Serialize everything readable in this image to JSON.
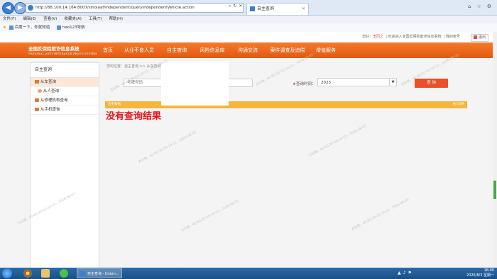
{
  "browser": {
    "url": "http://88.100.14.164:8007/sinoiaaf/independent/queryIndependentVehicle.action",
    "tab_title": "自主查询",
    "menu": [
      "文件(F)",
      "编辑(E)",
      "查看(V)",
      "收藏夹(A)",
      "工具(T)",
      "帮助(H)"
    ],
    "favorites": [
      "百度一下，你就知道",
      "hao123导航"
    ]
  },
  "site": {
    "greeting": "您好：",
    "user": "李同之",
    "welcome": "欢迎进入全国反保险欺诈信息系统",
    "my_account": "我的帐号",
    "logout": "退出",
    "logo_title": "全国反保险欺诈信息系统",
    "logo_subtitle": "NATIONAL ANTI INSURANCE FRAUD SYSTEM",
    "nav": [
      "首页",
      "从业不良人员",
      "自主查询",
      "风险信息库",
      "沟通交流",
      "案件调查及追偿",
      "增值服务"
    ]
  },
  "sidebar": {
    "title": "自主查询",
    "items": [
      "从车查询",
      "从人查询",
      "从修理机构查询",
      "从手机查询"
    ]
  },
  "content": {
    "breadcrumb": "您的位置：自主查询 >> 从车查询",
    "plate_placeholder": "号牌号码",
    "time_label": "查询时间：",
    "year_value": "2023",
    "query_button": "查 询",
    "result_left": "历史数据",
    "result_right": "共计0条",
    "no_result": "没有查询结果"
  },
  "watermark": "方石晓，40-80-20-20-14-11，2026-08-03",
  "taskbar": {
    "task_label": "自主查询 - Intern...",
    "time": "18:00",
    "date": "2026/8/3 星期一"
  },
  "colors": {
    "nav_orange": "#e96a1f",
    "query_button": "#e8512a",
    "result_bar": "#f7b53c",
    "no_result_text": "#e8121a"
  }
}
